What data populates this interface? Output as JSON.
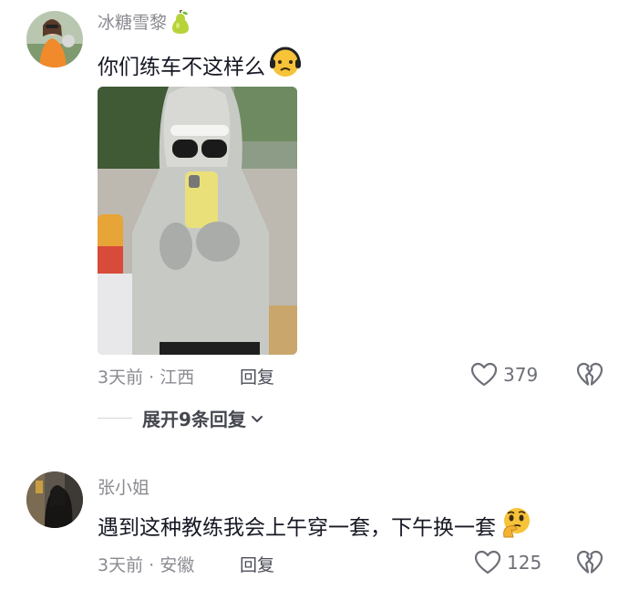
{
  "comments": [
    {
      "username": "冰糖雪黎",
      "text": "你们练车不这样么",
      "meta": "3天前 · 江西",
      "reply_label": "回复",
      "likes": "379",
      "expand_label": "展开9条回复"
    },
    {
      "username": "张小姐",
      "text": "遇到这种教练我会上午穿一套，下午换一套",
      "meta": "3天前 · 安徽",
      "reply_label": "回复",
      "likes": "125"
    }
  ],
  "icons": {
    "username_badge": "pear-icon",
    "emoji_1": "sad-face-emoji",
    "emoji_2": "thinking-face-emoji",
    "like": "heart-outline-icon",
    "dislike": "broken-heart-icon",
    "expand": "chevron-down-icon"
  },
  "colors": {
    "secondary_text": "#8a8b91",
    "primary_text": "#161823",
    "emoji_yellow": "#f6c339"
  }
}
